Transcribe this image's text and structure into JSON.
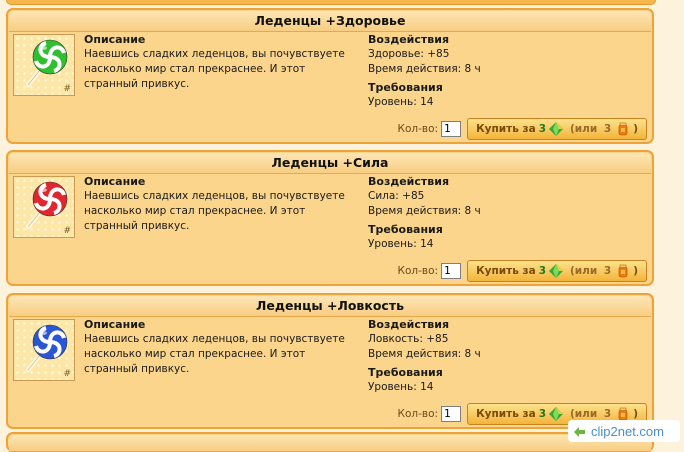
{
  "products": [
    {
      "title": "Леденцы +Здоровье",
      "candy_color": "#2fbf2f",
      "description_title": "Описание",
      "description": "Наевшись сладких леденцов, вы почувствуете насколько мир стал прекраснее. И этот странный привкус.",
      "effects_title": "Воздействия",
      "effect_stat": "Здоровье: +85",
      "duration": "Время действия: 8 ч",
      "requirements_title": "Требования",
      "requirement": "Уровень: 14",
      "qty_label": "Кол-во:",
      "qty_value": "1",
      "buy_prefix": "Купить за",
      "price_gems": "3",
      "alt_prefix": "(или",
      "price_alt": "3",
      "alt_suffix": ")"
    },
    {
      "title": "Леденцы +Сила",
      "candy_color": "#e0262e",
      "description_title": "Описание",
      "description": "Наевшись сладких леденцов, вы почувствуете насколько мир стал прекраснее. И этот странный привкус.",
      "effects_title": "Воздействия",
      "effect_stat": "Сила: +85",
      "duration": "Время действия: 8 ч",
      "requirements_title": "Требования",
      "requirement": "Уровень: 14",
      "qty_label": "Кол-во:",
      "qty_value": "1",
      "buy_prefix": "Купить за",
      "price_gems": "3",
      "alt_prefix": "(или",
      "price_alt": "3",
      "alt_suffix": ")"
    },
    {
      "title": "Леденцы +Ловкость",
      "candy_color": "#2a56d6",
      "description_title": "Описание",
      "description": "Наевшись сладких леденцов, вы почувствуете насколько мир стал прекраснее. И этот странный привкус.",
      "effects_title": "Воздействия",
      "effect_stat": "Ловкость: +85",
      "duration": "Время действия: 8 ч",
      "requirements_title": "Требования",
      "requirement": "Уровень: 14",
      "qty_label": "Кол-во:",
      "qty_value": "1",
      "buy_prefix": "Купить за",
      "price_gems": "3",
      "alt_prefix": "(или",
      "price_alt": "3",
      "alt_suffix": ")"
    }
  ],
  "thumb_hash": "#",
  "icons": {
    "candy": "lollipop-icon",
    "currency": "green-gem-icon",
    "alt_currency": "honey-jar-icon"
  },
  "watermark": "clip2net.com"
}
